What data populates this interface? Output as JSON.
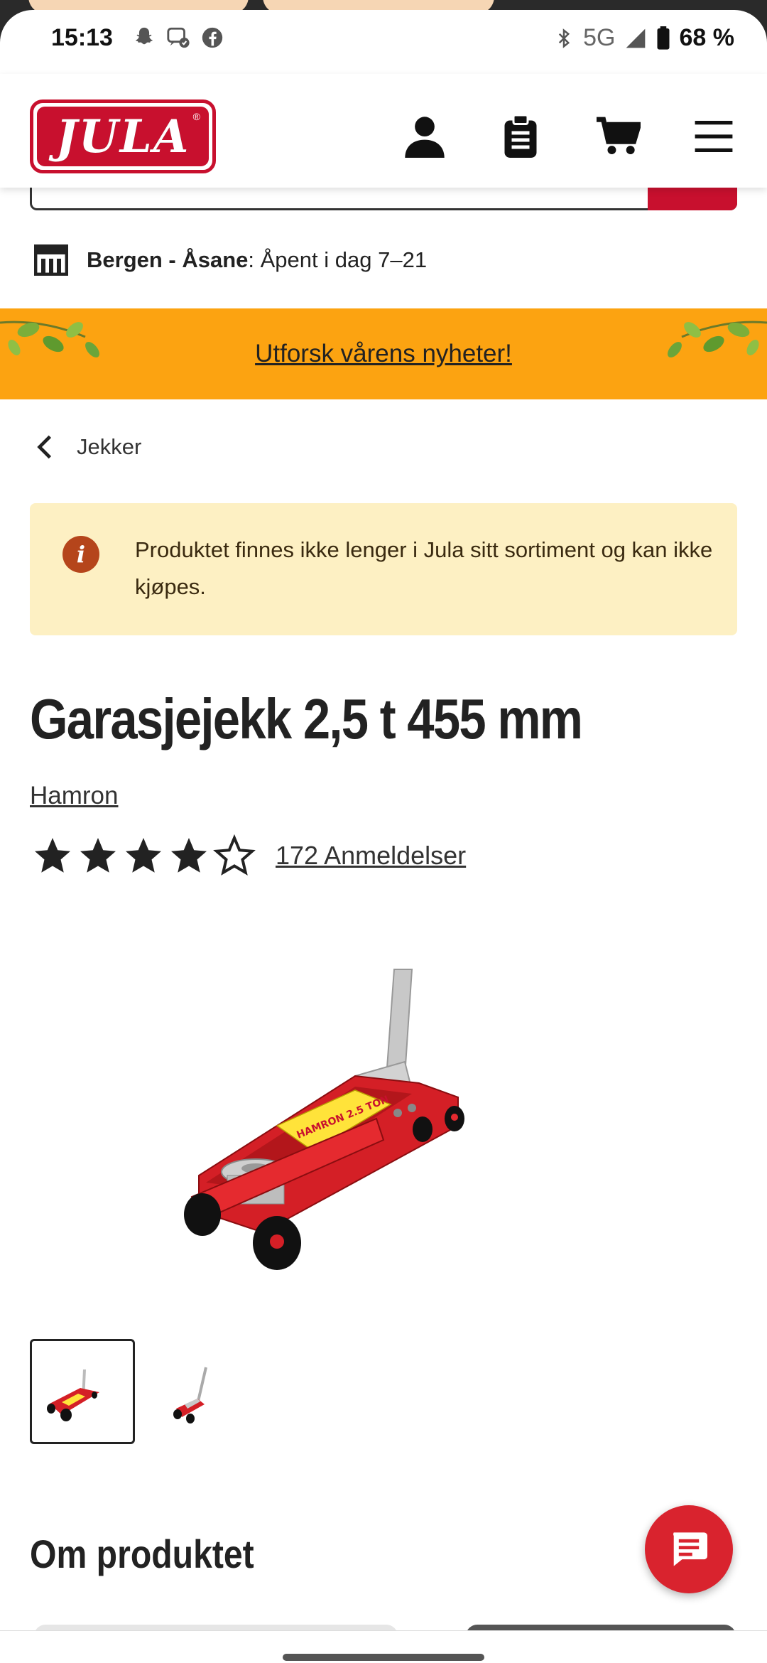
{
  "status_bar": {
    "time": "15:13",
    "network": "5G",
    "battery": "68 %",
    "icons": [
      "snapchat-icon",
      "messenger-icon",
      "facebook-icon",
      "bluetooth-icon",
      "signal-icon",
      "battery-icon"
    ]
  },
  "header": {
    "logo_text": "JULA",
    "logo_reg": "®",
    "icons": [
      "account-icon",
      "shopping-list-icon",
      "cart-icon",
      "menu-icon"
    ]
  },
  "store": {
    "name": "Bergen - Åsane",
    "hours": ": Åpent i dag 7–21"
  },
  "promo": {
    "link_text": "Utforsk vårens nyheter!"
  },
  "breadcrumb": {
    "label": "Jekker"
  },
  "notice": {
    "text": "Produktet finnes ikke lenger i Jula sitt sortiment og kan ikke kjøpes."
  },
  "product": {
    "title": "Garasjejekk 2,5 t 455 mm",
    "brand": "Hamron",
    "rating": 4,
    "rating_max": 5,
    "reviews": "172 Anmeldelser",
    "jack_label": "HAMRON 2.5 TON"
  },
  "section": {
    "about_title": "Om produktet"
  },
  "colors": {
    "brand_red": "#c8102e",
    "promo_orange": "#fca311",
    "notice_bg": "#fdf0c3",
    "chat_red": "#d9232e"
  }
}
